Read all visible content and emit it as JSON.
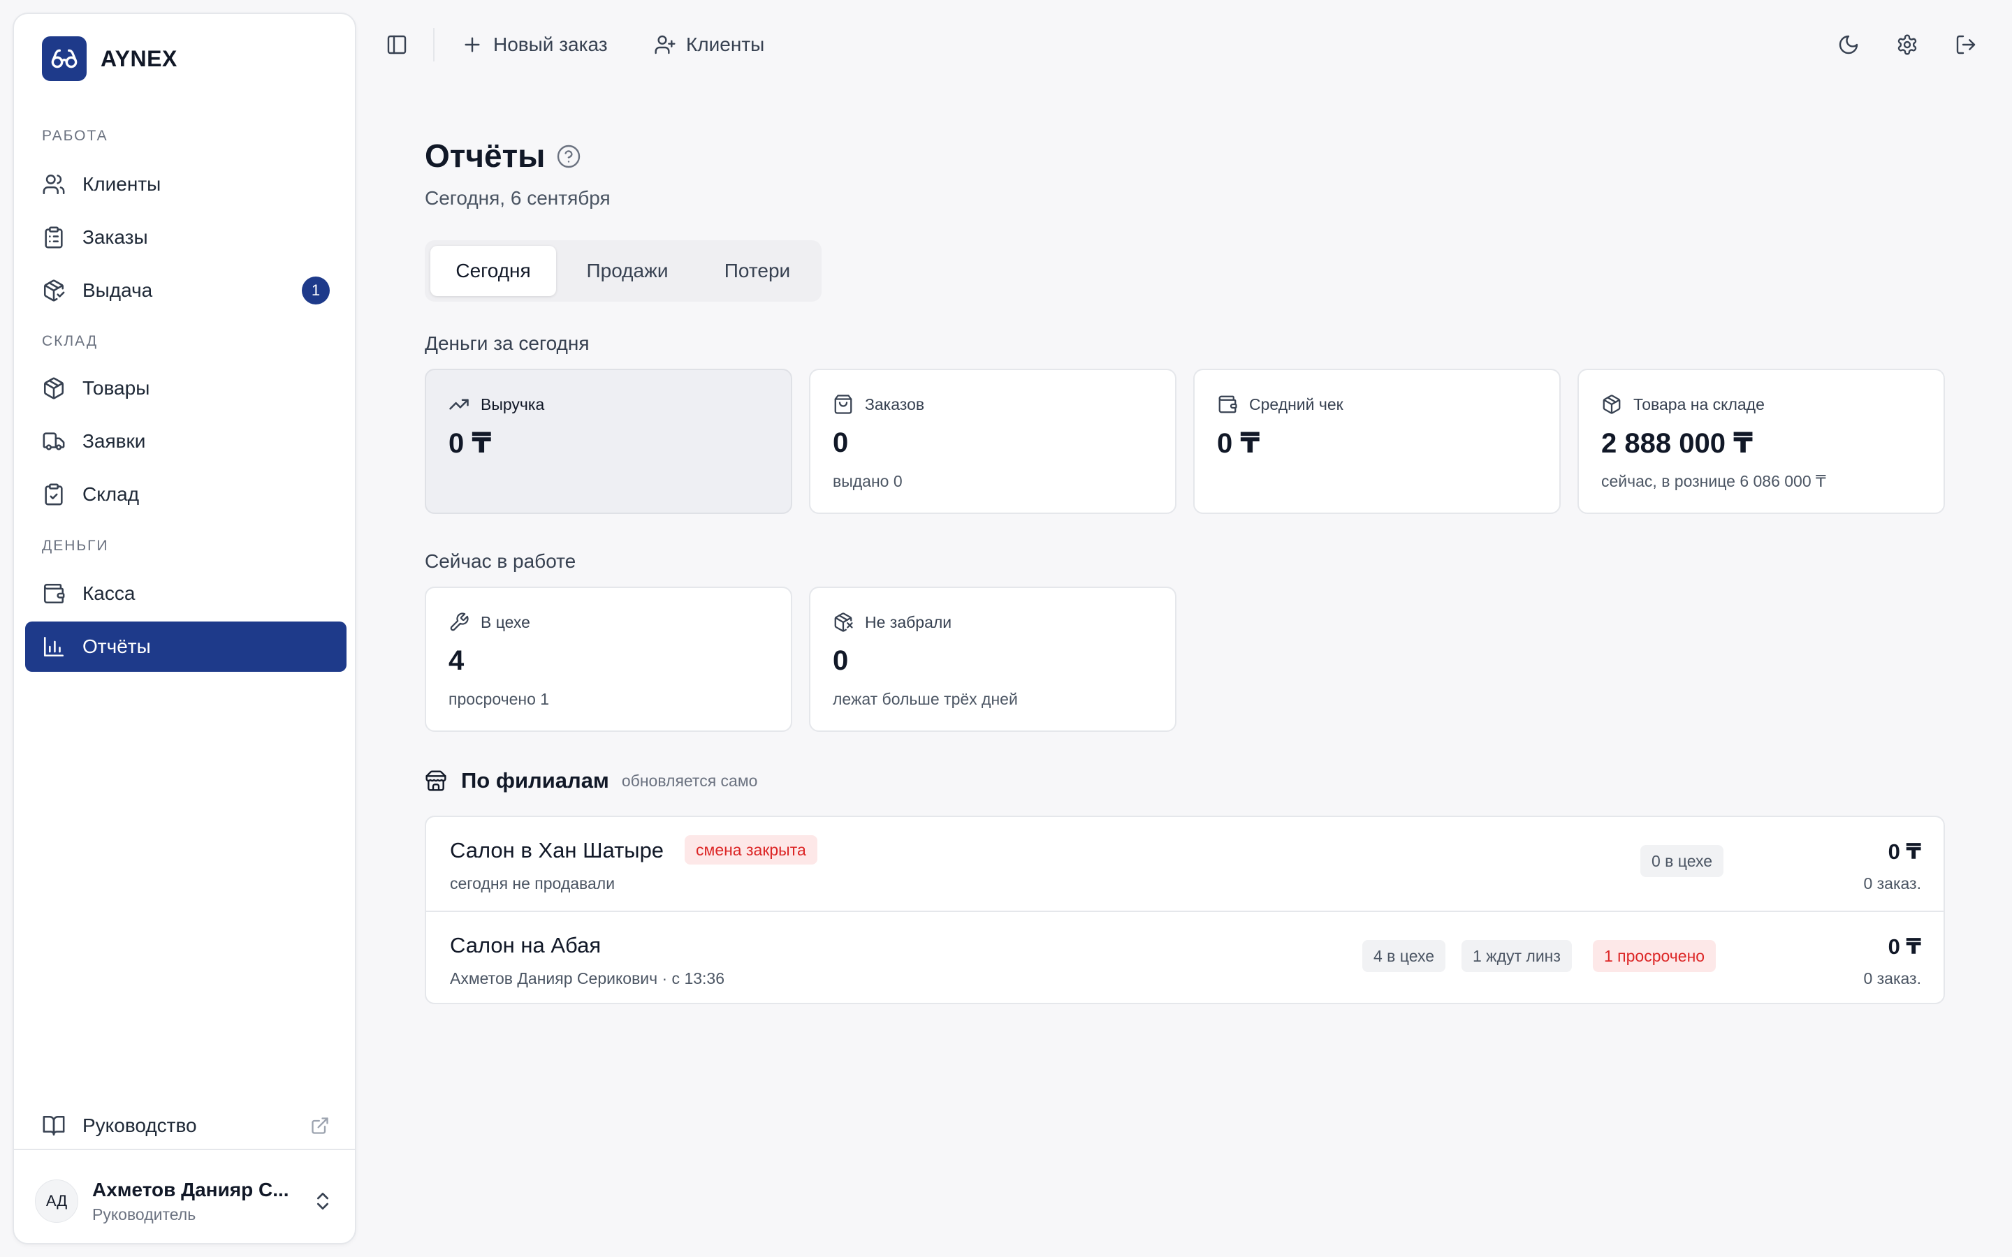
{
  "brand": {
    "name": "AYNEX"
  },
  "sidebar": {
    "sections": [
      {
        "title": "Работа"
      },
      {
        "title": "Склад"
      },
      {
        "title": "Деньги"
      }
    ],
    "items": [
      {
        "label": "Клиенты",
        "icon": "users-icon"
      },
      {
        "label": "Заказы",
        "icon": "clipboard-list-icon"
      },
      {
        "label": "Выдача",
        "icon": "package-check-icon",
        "badge": "1"
      },
      {
        "label": "Товары",
        "icon": "box-icon"
      },
      {
        "label": "Заявки",
        "icon": "truck-icon"
      },
      {
        "label": "Склад",
        "icon": "clipboard-check-icon"
      },
      {
        "label": "Касса",
        "icon": "wallet-icon"
      },
      {
        "label": "Отчёты",
        "icon": "bar-chart-icon",
        "active": true
      }
    ],
    "guide": {
      "label": "Руководство"
    },
    "user": {
      "initials": "АД",
      "name": "Ахметов Данияр С...",
      "role": "Руководитель"
    }
  },
  "topbar": {
    "new_order": "Новый заказ",
    "clients": "Клиенты"
  },
  "page": {
    "title": "Отчёты",
    "date": "Сегодня, 6 сентября",
    "tabs": [
      "Сегодня",
      "Продажи",
      "Потери"
    ],
    "active_tab": "Сегодня"
  },
  "money_today": {
    "title": "Деньги за сегодня",
    "cards": [
      {
        "label": "Выручка",
        "value": "0 ₸",
        "sub": ""
      },
      {
        "label": "Заказов",
        "value": "0",
        "sub": "выдано 0"
      },
      {
        "label": "Средний чек",
        "value": "0 ₸",
        "sub": ""
      },
      {
        "label": "Товара на складе",
        "value": "2 888 000 ₸",
        "sub": "сейчас, в рознице 6 086 000 ₸"
      }
    ]
  },
  "in_work": {
    "title": "Сейчас в работе",
    "cards": [
      {
        "label": "В цехе",
        "value": "4",
        "sub": "просрочено 1"
      },
      {
        "label": "Не забрали",
        "value": "0",
        "sub": "лежат больше трёх дней"
      }
    ]
  },
  "branches": {
    "title": "По филиалам",
    "subtitle": "обновляется само",
    "rows": [
      {
        "name": "Салон в Хан Шатыре",
        "status": "смена закрыта",
        "sub": "сегодня не продавали",
        "pills": [
          "0 в цехе"
        ],
        "amount": "0 ₸",
        "orders": "0 заказ."
      },
      {
        "name": "Салон на Абая",
        "sub": "Ахметов Данияр Серикович · с 13:36",
        "pills": [
          "4 в цехе",
          "1 ждут линз",
          "1 просрочено"
        ],
        "amount": "0 ₸",
        "orders": "0 заказ."
      }
    ]
  },
  "colors": {
    "accent": "#1e3a8a",
    "background": "#f7f7f9",
    "danger": "#dc2626",
    "danger_bg": "#fde8e8"
  }
}
